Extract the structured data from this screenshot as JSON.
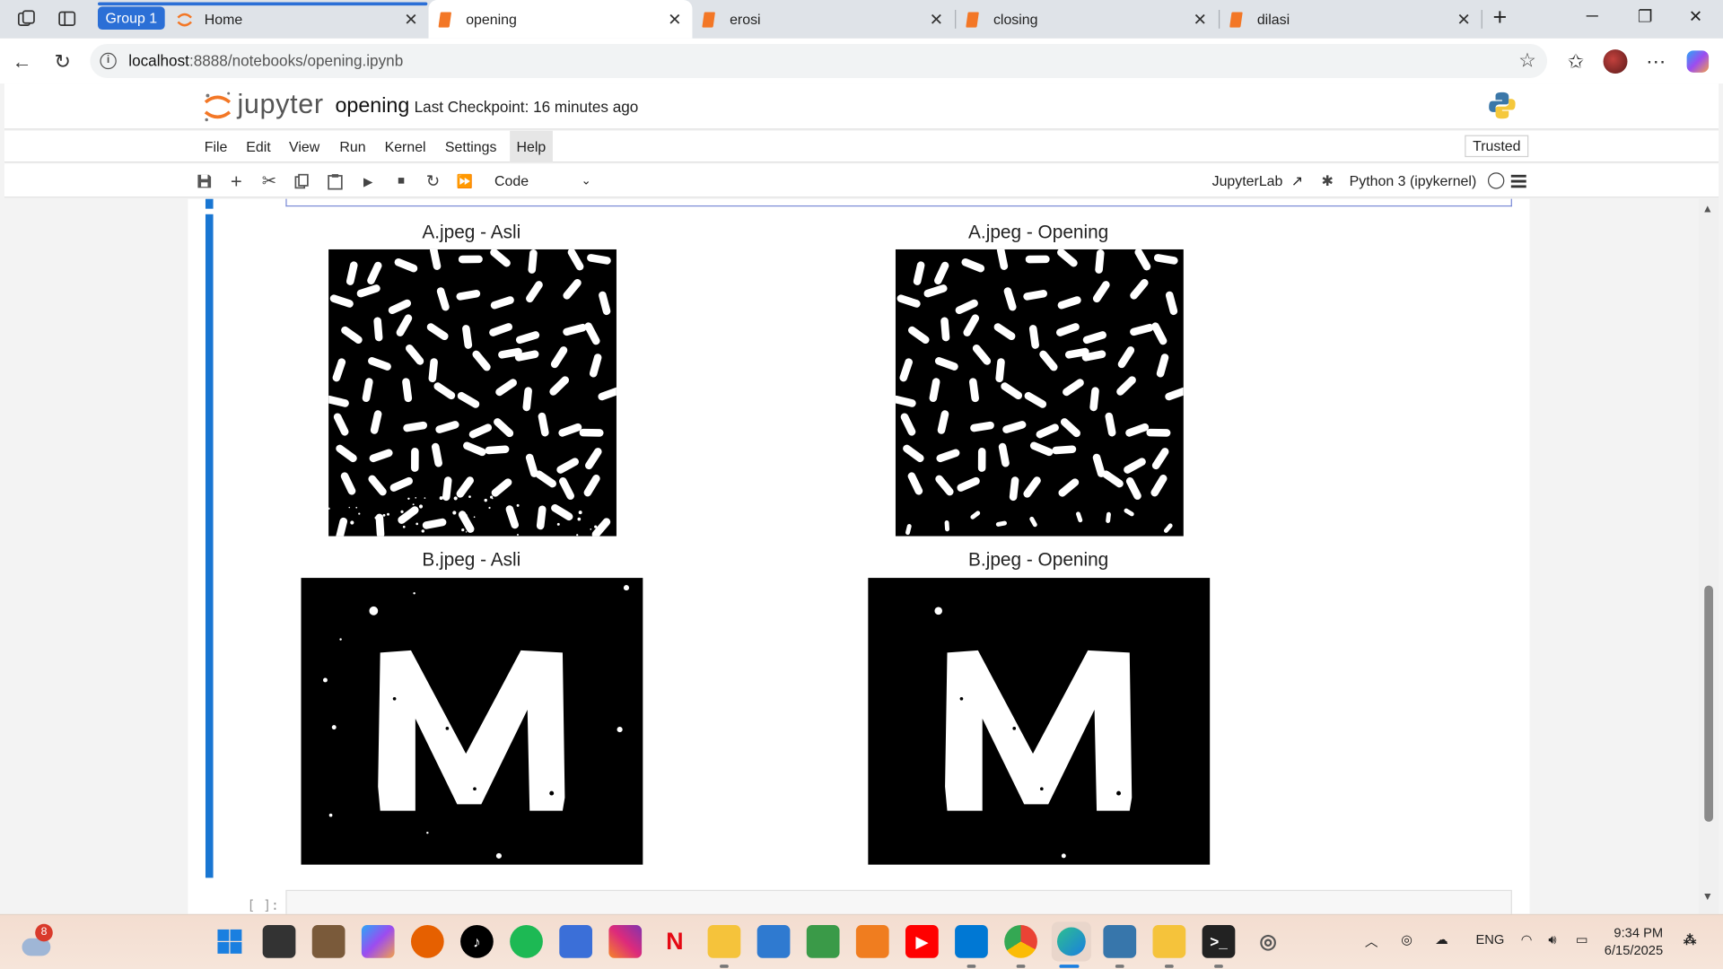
{
  "browser": {
    "group_label": "Group 1",
    "tabs": [
      {
        "label": "Home",
        "icon": "jupyter-icon",
        "active": false
      },
      {
        "label": "opening",
        "icon": "notebook-icon",
        "active": true
      },
      {
        "label": "erosi",
        "icon": "notebook-icon",
        "active": false
      },
      {
        "label": "closing",
        "icon": "notebook-icon",
        "active": false
      },
      {
        "label": "dilasi",
        "icon": "notebook-icon",
        "active": false
      }
    ],
    "url_host": "localhost",
    "url_rest": ":8888/notebooks/opening.ipynb"
  },
  "jupyter": {
    "logo_text": "jupyter",
    "notebook_name": "opening",
    "checkpoint": "Last Checkpoint: 16 minutes ago",
    "menu": [
      "File",
      "Edit",
      "View",
      "Run",
      "Kernel",
      "Settings",
      "Help"
    ],
    "trusted": "Trusted",
    "cell_type": "Code",
    "jupyterlab": "JupyterLab",
    "kernel": "Python 3 (ipykernel)",
    "next_prompt": "[ ]:"
  },
  "figures": [
    {
      "title": "A.jpeg - Asli"
    },
    {
      "title": "A.jpeg - Opening"
    },
    {
      "title": "B.jpeg - Asli"
    },
    {
      "title": "B.jpeg - Opening"
    }
  ],
  "taskbar": {
    "weather_badge": "8",
    "language": "ENG",
    "time": "9:34 PM",
    "date": "6/15/2025"
  },
  "colors": {
    "accent": "#1976d2",
    "jupyter_orange": "#f37726",
    "group_blue": "#2b6fd6"
  }
}
